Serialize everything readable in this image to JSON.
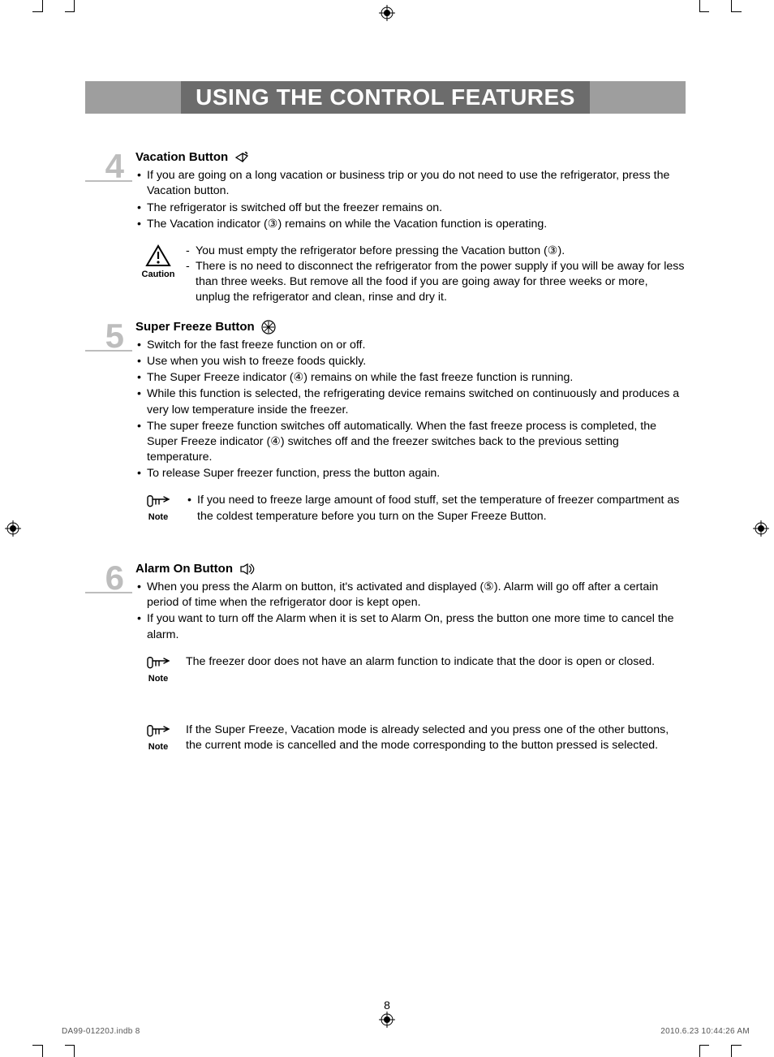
{
  "title": "USING THE CONTROL FEATURES",
  "sections": {
    "s4": {
      "num": "4",
      "heading": "Vacation Button",
      "bullets": [
        "If you are going on a long vacation or business trip or you do not need to use the refrigerator, press the Vacation button.",
        "The refrigerator is switched off but the freezer remains on.",
        "The Vacation indicator (③) remains on while the Vacation function is operating."
      ],
      "caution_label": "Caution",
      "caution_items": [
        "You must empty the refrigerator before pressing the Vacation button (③).",
        "There is no need to disconnect the refrigerator from the power supply if you will be away for less than three weeks. But remove all the food if you are going away for three weeks or more, unplug the refrigerator and clean, rinse and dry it."
      ]
    },
    "s5": {
      "num": "5",
      "heading": "Super Freeze Button",
      "bullets": [
        "Switch for the fast freeze function on or off.",
        "Use when you wish to freeze foods quickly.",
        "The Super Freeze indicator (④) remains on while the fast freeze function is running.",
        "While this function is selected, the refrigerating device remains switched on continuously and produces a very low temperature inside the freezer.",
        "The super freeze function switches off automatically. When the fast freeze process is completed, the Super Freeze indicator (④) switches off and the freezer switches back to the previous setting temperature.",
        "To release Super freezer function, press the button again."
      ],
      "note_label": "Note",
      "note_text": "If you need to freeze large amount of food stuff, set the temperature of freezer compartment as the coldest temperature before you turn on the Super Freeze Button."
    },
    "s6": {
      "num": "6",
      "heading": "Alarm On Button",
      "bullets": [
        "When you press the Alarm on button, it's activated and displayed (⑤). Alarm will go off after a certain period of time when the refrigerator door is kept open.",
        "If you want to turn off the Alarm when it is set to Alarm On, press the button one more time to cancel the alarm."
      ],
      "note_label": "Note",
      "note1": "The freezer door does not have an alarm function to indicate that the door is open or closed.",
      "note2": "If the Super Freeze, Vacation mode is already selected and you press one of the other buttons, the current mode is cancelled and the mode corresponding to the button pressed is selected."
    }
  },
  "page_number": "8",
  "footer_left": "DA99-01220J.indb   8",
  "footer_right": "2010.6.23   10:44:26 AM"
}
